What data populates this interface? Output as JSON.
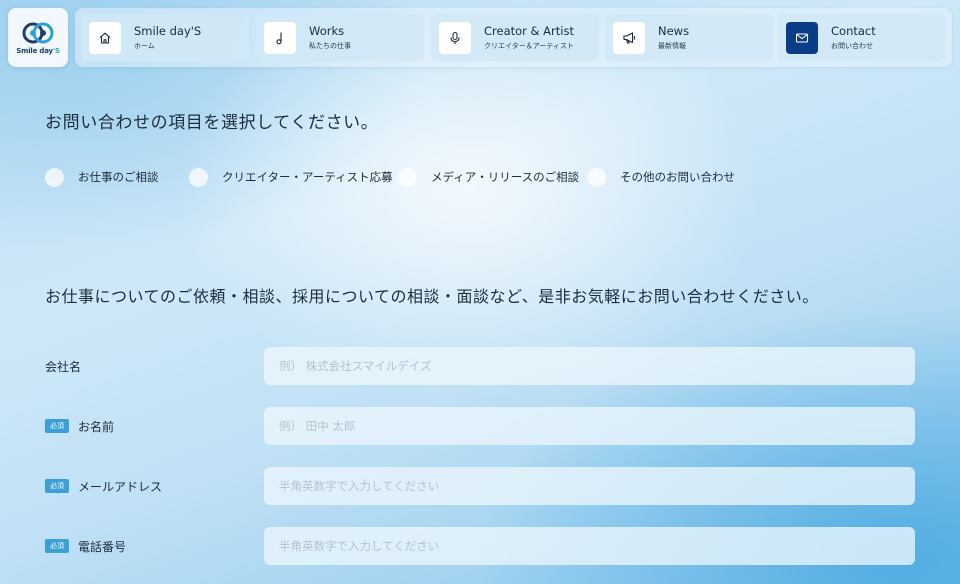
{
  "logo": {
    "name_main": "Smile day",
    "name_suffix": "'S"
  },
  "nav": [
    {
      "title": "Smile day'S",
      "sub": "ホーム",
      "icon": "home-icon"
    },
    {
      "title": "Works",
      "sub": "私たちの仕事",
      "icon": "music-note-icon"
    },
    {
      "title": "Creator & Artist",
      "sub": "クリエイター＆アーティスト",
      "icon": "microphone-icon"
    },
    {
      "title": "News",
      "sub": "最新情報",
      "icon": "megaphone-icon"
    },
    {
      "title": "Contact",
      "sub": "お問い合わせ",
      "icon": "mail-icon",
      "active": true
    }
  ],
  "inquiry": {
    "question": "お問い合わせの項目を選択してください。",
    "options": [
      {
        "label": "お仕事のご相談"
      },
      {
        "label": "クリエイター・アーティスト応募"
      },
      {
        "label": "メディア・リリースのご相談"
      },
      {
        "label": "その他のお問い合わせ"
      }
    ]
  },
  "lead": "お仕事についてのご依頼・相談、採用についての相談・面談など、是非お気軽にお問い合わせください。",
  "form": {
    "required_badge": "必須",
    "fields": [
      {
        "label": "会社名",
        "required": false,
        "placeholder": "例） 株式会社スマイルデイズ",
        "value": ""
      },
      {
        "label": "お名前",
        "required": true,
        "placeholder": "例） 田中 太郎",
        "value": ""
      },
      {
        "label": "メールアドレス",
        "required": true,
        "placeholder": "半角英数字で入力してください",
        "value": ""
      },
      {
        "label": "電話番号",
        "required": true,
        "placeholder": "半角英数字で入力してください",
        "value": ""
      }
    ]
  },
  "colors": {
    "accent": "#0b3d86",
    "badge": "#3b9fd8",
    "brand_light": "#2aa0dc"
  }
}
